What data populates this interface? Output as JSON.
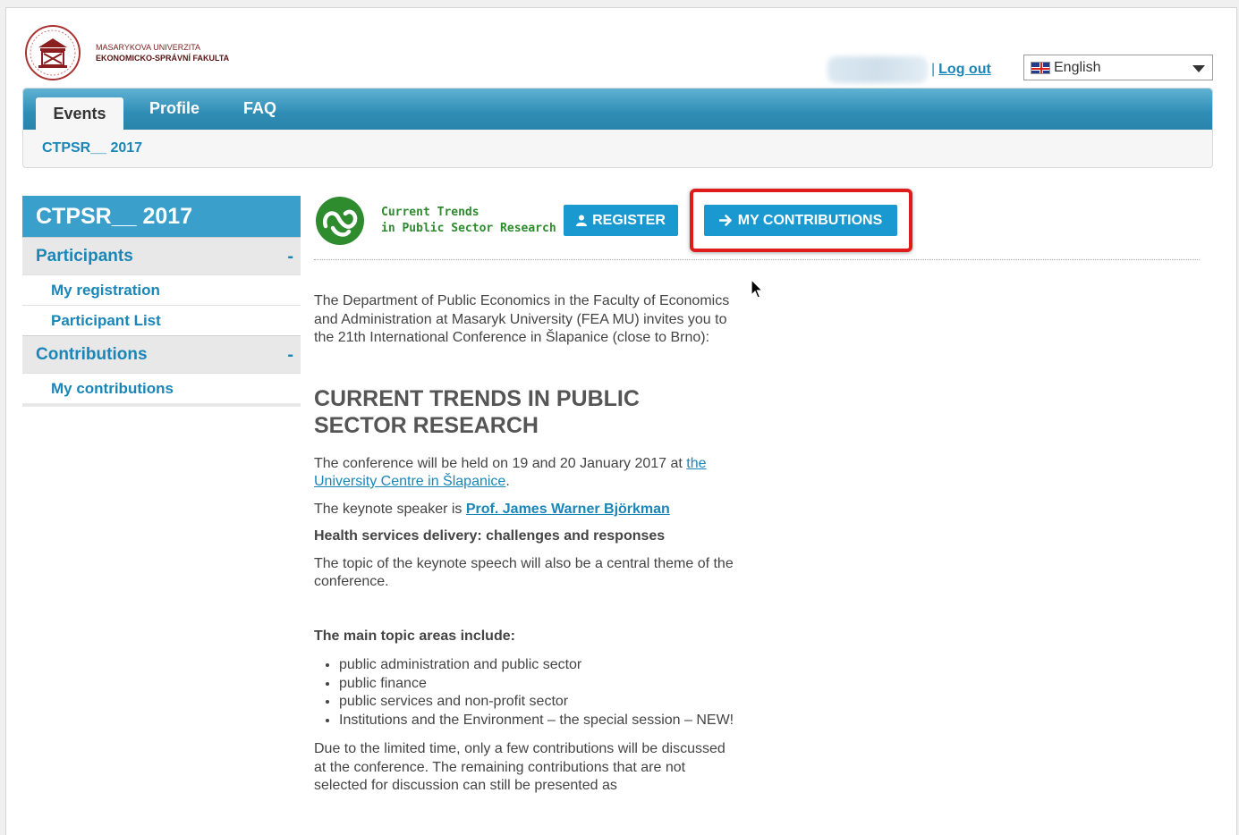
{
  "header": {
    "university_line1": "MASARYKOVA UNIVERZITA",
    "university_line2": "EKONOMICKO-SPRÁVNÍ FAKULTA",
    "separator": "|",
    "logout_label": "Log out",
    "language": {
      "selected": "English",
      "icon": "uk-flag-icon"
    }
  },
  "nav": {
    "tabs": [
      {
        "label": "Events"
      },
      {
        "label": "Profile"
      },
      {
        "label": "FAQ"
      }
    ],
    "breadcrumb": "CTPSR__ 2017"
  },
  "sidebar": {
    "title": "CTPSR__ 2017",
    "sections": [
      {
        "label": "Participants",
        "toggle": "-",
        "items": [
          {
            "label": "My registration"
          },
          {
            "label": "Participant List"
          }
        ]
      },
      {
        "label": "Contributions",
        "toggle": "-",
        "items": [
          {
            "label": "My contributions"
          }
        ]
      }
    ]
  },
  "main": {
    "conference_logo_line1": "Current Trends",
    "conference_logo_line2": "in Public Sector Research",
    "register_label": "REGISTER",
    "my_contributions_label": "MY CONTRIBUTIONS",
    "intro": "The Department of Public Economics in the Faculty of Economics and Administration at Masaryk University (FEA MU) invites you to the 21th International Conference in Šlapanice (close to Brno):",
    "heading": "CURRENT TRENDS IN PUBLIC SECTOR RESEARCH",
    "held_text": "The conference will be held on 19 and 20 January 2017 at ",
    "held_link": "the University Centre in Šlapanice",
    "held_end": ".",
    "keynote_text": "The keynote speaker is ",
    "keynote_link": "Prof. James Warner Björkman",
    "keynote_title": "Health services delivery: challenges and responses",
    "keynote_topic": "The topic of the keynote speech will also be a central theme of the conference.",
    "topics_heading": "The main topic areas include:",
    "topics": [
      "public administration and public sector",
      "public finance",
      "public services and non-profit sector",
      "Institutions and the Environment – the special session – NEW!"
    ],
    "closing": "Due to the limited time, only a few contributions will be discussed at the conference. The remaining contributions that are not selected for discussion can still be presented as"
  },
  "colors": {
    "accent": "#1999d0",
    "link": "#1a86b8",
    "highlight": "#e01b1b",
    "brand": "#7a1f1f"
  }
}
